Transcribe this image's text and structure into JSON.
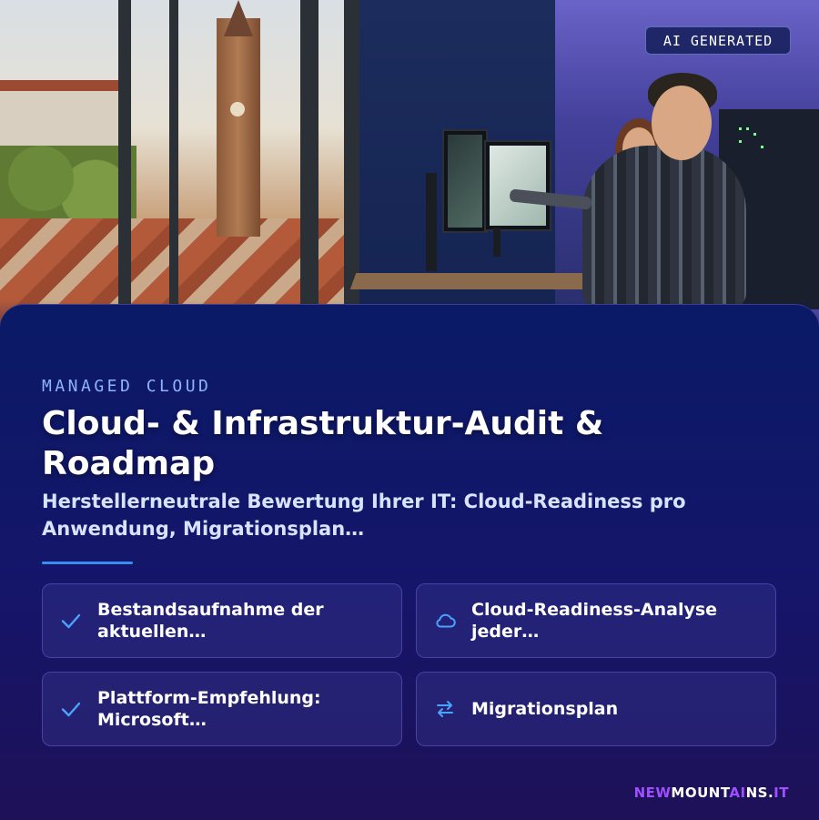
{
  "badge": {
    "label": "AI GENERATED"
  },
  "header": {
    "eyebrow": "MANAGED CLOUD",
    "title": "Cloud- & Infrastruktur-Audit & Roadmap",
    "subtitle": "Herstellerneutrale Bewertung Ihrer IT: Cloud-Readiness pro Anwendung, Migrationsplan…"
  },
  "features": [
    {
      "icon": "check-icon",
      "label": "Bestandsaufnahme der aktuellen…"
    },
    {
      "icon": "cloud-icon",
      "label": "Cloud-Readiness-Analyse jeder…"
    },
    {
      "icon": "check-icon",
      "label": "Plattform-Empfehlung: Microsoft…"
    },
    {
      "icon": "arrows-swap-icon",
      "label": "Migrationsplan"
    }
  ],
  "brand": {
    "part1": "NEW",
    "part2": "MOUNT",
    "part3": "AI",
    "part4": "NS",
    "part5": ".",
    "part6": "IT"
  },
  "colors": {
    "accent": "#3b8cf0",
    "brand_purple": "#a04fff",
    "icon_blue": "#4aa3ff"
  }
}
